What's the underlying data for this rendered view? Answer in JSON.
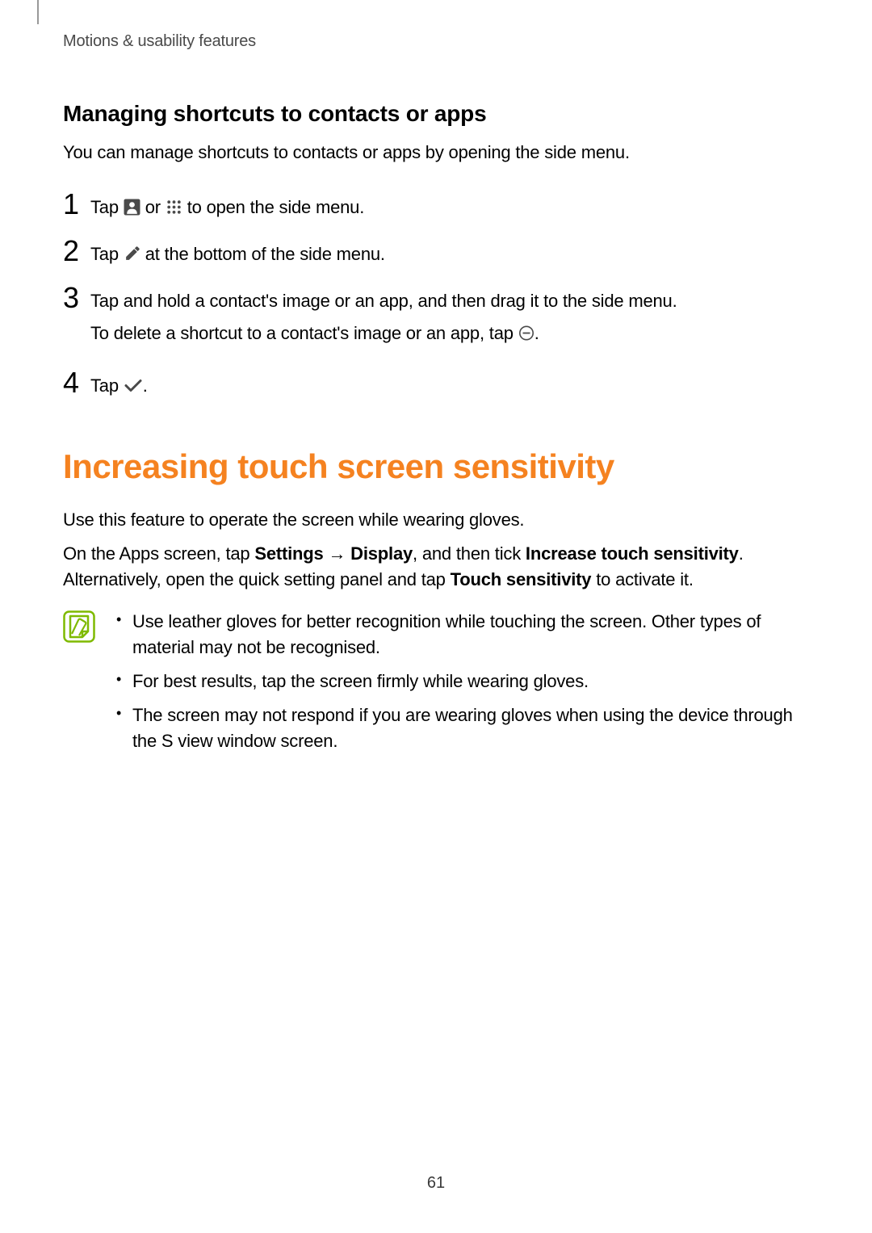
{
  "header": {
    "breadcrumb": "Motions & usability features"
  },
  "section1": {
    "title": "Managing shortcuts to contacts or apps",
    "intro": "You can manage shortcuts to contacts or apps by opening the side menu.",
    "steps": [
      {
        "num": "1",
        "pre": "Tap ",
        "between": " or ",
        "post": " to open the side menu."
      },
      {
        "num": "2",
        "pre": "Tap ",
        "post": " at the bottom of the side menu."
      },
      {
        "num": "3",
        "line1": "Tap and hold a contact's image or an app, and then drag it to the side menu.",
        "line2_pre": "To delete a shortcut to a contact's image or an app, tap ",
        "line2_post": "."
      },
      {
        "num": "4",
        "pre": "Tap ",
        "post": "."
      }
    ]
  },
  "section2": {
    "title": "Increasing touch screen sensitivity",
    "intro": "Use this feature to operate the screen while wearing gloves.",
    "para2": {
      "t1": "On the Apps screen, tap ",
      "b1": "Settings",
      "t2": " → ",
      "b2": "Display",
      "t3": ", and then tick ",
      "b3": "Increase touch sensitivity",
      "t4": ". Alternatively, open the quick setting panel and tap ",
      "b4": "Touch sensitivity",
      "t5": " to activate it."
    },
    "notes": [
      "Use leather gloves for better recognition while touching the screen. Other types of material may not be recognised.",
      "For best results, tap the screen firmly while wearing gloves.",
      "The screen may not respond if you are wearing gloves when using the device through the S view window screen."
    ]
  },
  "page_number": "61"
}
